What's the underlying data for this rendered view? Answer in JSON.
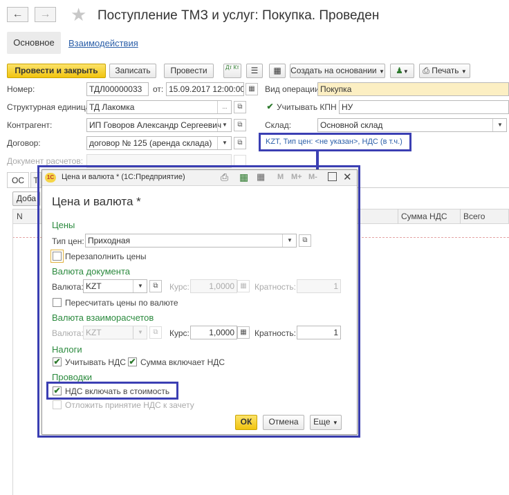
{
  "window": {
    "title": "Поступление ТМЗ и услуг: Покупка. Проведен"
  },
  "tabs": {
    "main": "Основное",
    "interactions": "Взаимодействия"
  },
  "toolbar": {
    "post_close": "Провести и закрыть",
    "save": "Записать",
    "post": "Провести",
    "create_based": "Создать на основании",
    "print": "Печать",
    "dt_kt": "Дт Кт"
  },
  "form": {
    "number_label": "Номер:",
    "number_value": "ТДЛ00000033",
    "date_label": "от:",
    "date_value": "15.09.2017 12:00:00",
    "operation_label": "Вид операции:",
    "operation_value": "Покупка",
    "unit_label": "Структурная единица:",
    "unit_value": "ТД Лакомка",
    "kpn_label": "Учитывать КПН",
    "kpn_value": "НУ",
    "counterparty_label": "Контрагент:",
    "counterparty_value": "ИП Говоров Александр Сергеевич",
    "warehouse_label": "Склад:",
    "warehouse_value": "Основной склад",
    "contract_label": "Договор:",
    "contract_value": "договор № 125 (аренда склада)",
    "price_link": "KZT, Тип цен: <не указан>, НДС (в т.ч.)",
    "settlement_doc_label": "Документ расчетов:"
  },
  "lower": {
    "tab_os": "ОС",
    "tab_t": "Т",
    "add_button": "Доба",
    "col_n": "N",
    "col_vat_sum": "Сумма НДС",
    "col_total": "Всего"
  },
  "dialog": {
    "caption": "Цена и валюта *  (1С:Предприятие)",
    "title": "Цена и валюта *",
    "sec_prices": "Цены",
    "price_type_label": "Тип цен:",
    "price_type_value": "Приходная",
    "refill_prices": "Перезаполнить цены",
    "sec_doc_currency": "Валюта документа",
    "currency_label": "Валюта:",
    "currency_value": "KZT",
    "rate_label": "Курс:",
    "rate_value": "1,0000",
    "multiplicity_label": "Кратность:",
    "multiplicity_value": "1",
    "recalc_prices": "Пересчитать цены по валюте",
    "sec_settle_currency": "Валюта взаиморасчетов",
    "settle_currency_label": "Валюта:",
    "settle_currency_value": "KZT",
    "settle_rate_label": "Курс:",
    "settle_rate_value": "1,0000",
    "settle_mult_label": "Кратность:",
    "settle_mult_value": "1",
    "sec_taxes": "Налоги",
    "consider_vat": "Учитывать НДС",
    "sum_includes_vat": "Сумма включает НДС",
    "sec_postings": "Проводки",
    "vat_in_cost": "НДС включать в стоимость",
    "defer_vat": "Отложить принятие НДС к зачету",
    "ok": "ОК",
    "cancel": "Отмена",
    "more": "Еще",
    "mem_m": "M",
    "mem_mplus": "M+",
    "mem_mminus": "M-"
  },
  "colors": {
    "highlight": "#3b3fb3",
    "primary_button": "#f1c40f",
    "section_green": "#2b8a3e",
    "link_blue": "#2a5ea8"
  }
}
